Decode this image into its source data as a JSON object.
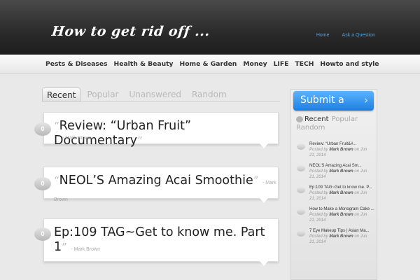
{
  "header": {
    "site_title": "How to get rid off ...",
    "links": [
      "Home",
      "Ask a Question"
    ]
  },
  "nav": {
    "items": [
      "Pests & Diseases",
      "Health & Beauty",
      "Home & Garden",
      "Money",
      "LIFE",
      "TECH",
      "Howto and style"
    ]
  },
  "main_tabs": [
    "Recent",
    "Popular",
    "Unanswered",
    "Random"
  ],
  "posts": [
    {
      "count": "0",
      "title": "Review: “Urban Fruit” Documentary",
      "author": "- Mark Brown"
    },
    {
      "count": "0",
      "title": "NEOL’S Amazing Acai Smoothie",
      "author": "- Mark Brown"
    },
    {
      "count": "0",
      "title_line1": "Ep:109 TAG~Get to know me. Part",
      "title_line2": "1",
      "author": "- Mark Brown"
    }
  ],
  "sidebar": {
    "submit_label": "Submit a",
    "tabs": [
      "Recent",
      "Popular",
      "Random"
    ],
    "items": [
      {
        "title": "Review: “Urban Fruit&#...",
        "posted_by": "Posted by",
        "author": "Mark Brown",
        "on": "on Jun",
        "date": "21, 2014"
      },
      {
        "title": "NEOL’S Amazing Acai Sm...",
        "posted_by": "Posted by",
        "author": "Mark Brown",
        "on": "on Jun",
        "date": "21, 2014"
      },
      {
        "title": "Ep:109 TAG~Get to know me. P...",
        "posted_by": "Posted by",
        "author": "Mark Brown",
        "on": "on Jun",
        "date": "21, 2014"
      },
      {
        "title": "How to Make a Monogram Cake ...",
        "posted_by": "Posted by",
        "author": "Mark Brown",
        "on": "on Jun",
        "date": "21, 2014"
      },
      {
        "title": "7 Eye Makeup Tips | Asian Ma...",
        "posted_by": "Posted by",
        "author": "Mark Brown",
        "on": "on Jun",
        "date": "21, 2014"
      }
    ]
  },
  "colors": {
    "accent": "#1b7fe0",
    "header_bg": "#2a2a2a",
    "link": "#4aa3e6"
  },
  "quote_open": "“",
  "quote_close": "”"
}
